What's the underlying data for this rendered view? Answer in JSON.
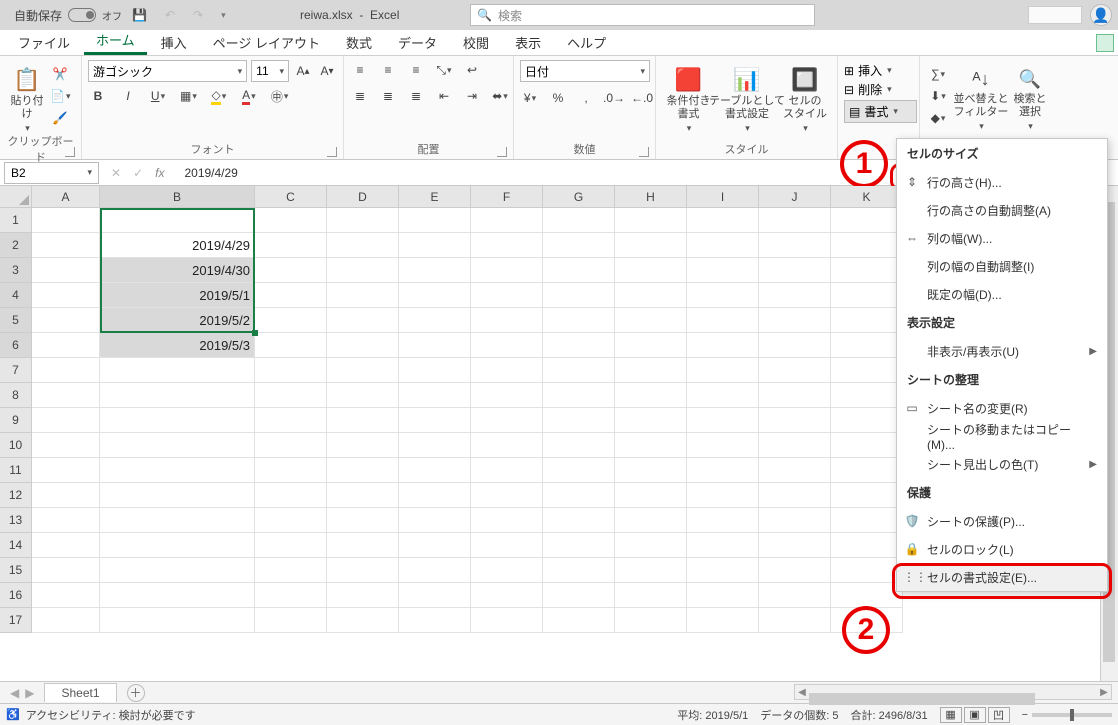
{
  "titlebar": {
    "autosave_label": "自動保存",
    "autosave_state": "オフ",
    "filename": "reiwa.xlsx",
    "appname": "Excel",
    "search_placeholder": "検索"
  },
  "tabs": {
    "items": [
      "ファイル",
      "ホーム",
      "挿入",
      "ページ レイアウト",
      "数式",
      "データ",
      "校閲",
      "表示",
      "ヘルプ"
    ],
    "active_index": 1
  },
  "ribbon": {
    "clipboard": {
      "paste_label": "貼り付け",
      "group": "クリップボード"
    },
    "font": {
      "name": "游ゴシック",
      "size": "11",
      "group": "フォント"
    },
    "align": {
      "group": "配置"
    },
    "number": {
      "format": "日付",
      "group": "数値"
    },
    "styles": {
      "cond_fmt": "条件付き\n書式",
      "table_fmt": "テーブルとして\n書式設定",
      "cell_styles": "セルの\nスタイル",
      "group": "スタイル"
    },
    "cells": {
      "insert": "挿入",
      "delete": "削除",
      "format": "書式"
    },
    "editing": {
      "sort": "並べ替えと\nフィルター",
      "find": "検索と\n選択"
    }
  },
  "formula_bar": {
    "name_box": "B2",
    "formula": "2019/4/29"
  },
  "grid": {
    "col_headers": [
      "A",
      "B",
      "C",
      "D",
      "E",
      "F",
      "G",
      "H",
      "I",
      "J",
      "K"
    ],
    "row_count": 17,
    "selected_rows": [
      2,
      3,
      4,
      5,
      6
    ],
    "selected_col_index": 1,
    "data": {
      "B2": "2019/4/29",
      "B3": "2019/4/30",
      "B4": "2019/5/1",
      "B5": "2019/5/2",
      "B6": "2019/5/3"
    }
  },
  "context_menu": {
    "sections": {
      "cell_size": "セルのサイズ",
      "visibility": "表示設定",
      "organize": "シートの整理",
      "protection": "保護"
    },
    "items": {
      "row_height": "行の高さ(H)...",
      "autofit_row": "行の高さの自動調整(A)",
      "col_width": "列の幅(W)...",
      "autofit_col": "列の幅の自動調整(I)",
      "default_width": "既定の幅(D)...",
      "hide_unhide": "非表示/再表示(U)",
      "rename_sheet": "シート名の変更(R)",
      "move_copy": "シートの移動またはコピー(M)...",
      "tab_color": "シート見出しの色(T)",
      "protect_sheet": "シートの保護(P)...",
      "lock_cell": "セルのロック(L)",
      "format_cells": "セルの書式設定(E)..."
    }
  },
  "sheet_tabs": {
    "active": "Sheet1"
  },
  "status_bar": {
    "accessibility": "アクセシビリティ: 検討が必要です",
    "avg_label": "平均:",
    "avg": "2019/5/1",
    "count_label": "データの個数:",
    "count": "5",
    "sum_label": "合計:",
    "sum": "2496/8/31"
  },
  "annotations": {
    "n1": "1",
    "n2": "2"
  }
}
